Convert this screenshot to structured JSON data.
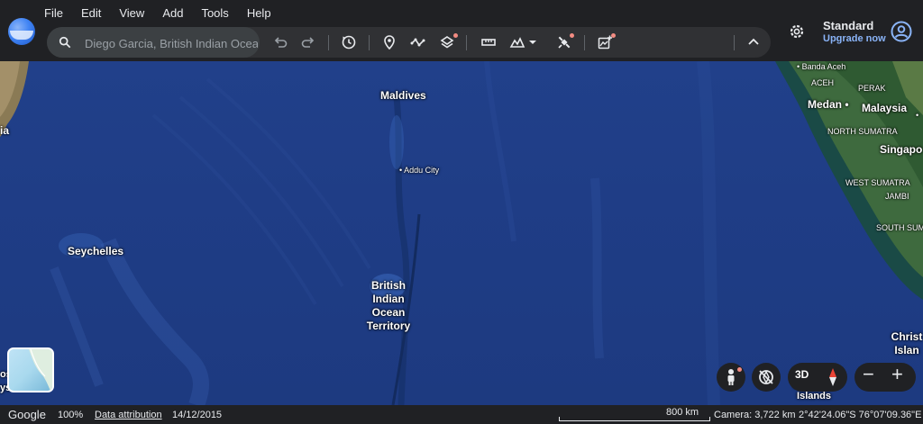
{
  "menu": [
    "File",
    "Edit",
    "View",
    "Add",
    "Tools",
    "Help"
  ],
  "search": {
    "value": "Diego Garcia, British Indian Ocean Territory"
  },
  "toolbar_icons": [
    "undo-icon",
    "redo-icon",
    "history-icon",
    "placemark-icon",
    "path-icon",
    "layers-icon",
    "ruler-icon",
    "map-style-icon",
    "satellite-icon",
    "add-content-icon",
    "collapse-icon"
  ],
  "account": {
    "plan": "Standard",
    "upgrade": "Upgrade now"
  },
  "map_labels": {
    "maldives": "Maldives",
    "addu": "Addu City",
    "seychelles": "Seychelles",
    "biot": "British Indian Ocean Territory",
    "banda_aceh": "Banda Aceh",
    "aceh": "ACEH",
    "perak": "PERAK",
    "medan": "Medan",
    "malaysia": "Malaysia",
    "north_sumatra": "NORTH SUMATRA",
    "singapore": "Singapo",
    "west_sumatra": "WEST SUMATRA",
    "jambi": "JAMBI",
    "south_sumatra": "SOUTH SUM",
    "christmas": "Christ Islan",
    "cocos": "Cocos (Keeling) Islands",
    "left_edge": "ia",
    "left_bottom": "os ys",
    "threed": "3D"
  },
  "map_controls": [
    "pegman-icon",
    "rotate-reset-icon",
    "compass-icon",
    "zoom-out",
    "zoom-in"
  ],
  "status": {
    "brand": "Google",
    "zoom": "100%",
    "attribution": "Data attribution",
    "date": "14/12/2015",
    "scale": "800 km",
    "camera": "Camera: 3,722 km",
    "coords": "2°42'24.06\"S 76°07'09.36\"E"
  },
  "colors": {
    "ocean": "#1f3d86",
    "toolbar": "#202124",
    "accent": "#8ab4f8",
    "notify": "#f28b82"
  }
}
